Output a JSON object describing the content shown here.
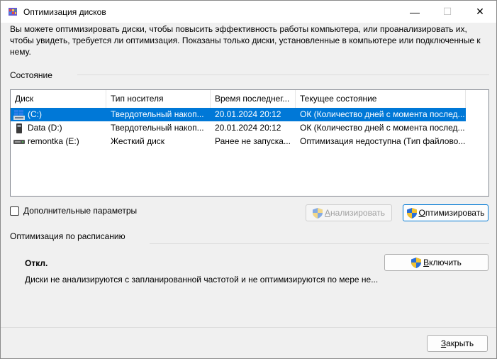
{
  "window": {
    "title": "Оптимизация дисков",
    "min_glyph": "—",
    "max_glyph": "☐",
    "close_glyph": "✕"
  },
  "description": "Вы можете оптимизировать диски, чтобы повысить эффективность работы  компьютера, или проанализировать их, чтобы увидеть, требуется ли оптимизация. Показаны только диски, установленные в компьютере или подключенные к нему.",
  "status_section": {
    "title": "Состояние",
    "columns": [
      "Диск",
      "Тип носителя",
      "Время последнег...",
      "Текущее состояние"
    ],
    "rows": [
      {
        "disk": "(C:)",
        "media": "Твердотельный накоп...",
        "last_run": "20.01.2024 20:12",
        "state": "ОК (Количество дней с момента послед...",
        "icon": "windows-drive-icon",
        "selected": true
      },
      {
        "disk": "Data (D:)",
        "media": "Твердотельный накоп...",
        "last_run": "20.01.2024 20:12",
        "state": "ОК (Количество дней с момента послед...",
        "icon": "ssd-drive-icon",
        "selected": false
      },
      {
        "disk": "remontka (E:)",
        "media": "Жесткий диск",
        "last_run": "Ранее не запуска...",
        "state": "Оптимизация недоступна (Тип файлово...",
        "icon": "hdd-drive-icon",
        "selected": false
      }
    ]
  },
  "advanced_checkbox_label": "Дополнительные параметры",
  "analyze_button": {
    "prefix": "",
    "accel": "А",
    "rest": "нализировать"
  },
  "optimize_button": {
    "prefix": "",
    "accel": "О",
    "rest": "птимизировать"
  },
  "schedule_section": {
    "title": "Оптимизация по расписанию",
    "status": "Откл.",
    "description": "Диски не анализируются с запланированной частотой и не оптимизируются по мере не...",
    "enable_button": {
      "prefix": "",
      "accel": "В",
      "rest": "ключить"
    }
  },
  "close_button": {
    "prefix": "",
    "accel": "З",
    "rest": "акрыть"
  },
  "colors": {
    "selection": "#0078d7",
    "accent": "#0078d4"
  }
}
